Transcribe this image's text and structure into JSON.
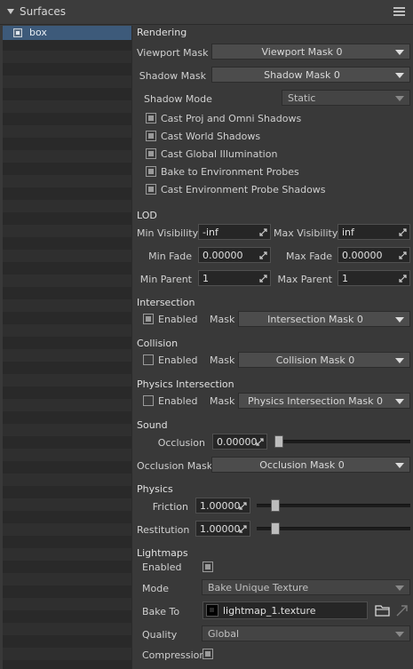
{
  "panel": {
    "title": "Surfaces",
    "menu_icon": "hamburger-icon"
  },
  "tree": {
    "items": [
      {
        "label": "box",
        "checked": true
      }
    ]
  },
  "rendering": {
    "title": "Rendering",
    "viewport_mask": {
      "label": "Viewport Mask",
      "value": "Viewport Mask 0"
    },
    "shadow_mask": {
      "label": "Shadow Mask",
      "value": "Shadow Mask 0"
    },
    "shadow_mode": {
      "label": "Shadow Mode",
      "value": "Static"
    },
    "checks": [
      {
        "label": "Cast Proj and Omni Shadows",
        "checked": true
      },
      {
        "label": "Cast World Shadows",
        "checked": true
      },
      {
        "label": "Cast Global Illumination",
        "checked": true
      },
      {
        "label": "Bake to Environment Probes",
        "checked": true
      },
      {
        "label": "Cast Environment Probe Shadows",
        "checked": true
      }
    ]
  },
  "lod": {
    "title": "LOD",
    "min_visibility": {
      "label": "Min Visibility",
      "value": "-inf"
    },
    "max_visibility": {
      "label": "Max Visibility",
      "value": "inf"
    },
    "min_fade": {
      "label": "Min Fade",
      "value": "0.00000"
    },
    "max_fade": {
      "label": "Max Fade",
      "value": "0.00000"
    },
    "min_parent": {
      "label": "Min Parent",
      "value": "1"
    },
    "max_parent": {
      "label": "Max Parent",
      "value": "1"
    }
  },
  "intersection": {
    "title": "Intersection",
    "enabled_label": "Enabled",
    "enabled": true,
    "mask_label": "Mask",
    "mask_value": "Intersection Mask 0"
  },
  "collision": {
    "title": "Collision",
    "enabled_label": "Enabled",
    "enabled": false,
    "mask_label": "Mask",
    "mask_value": "Collision Mask 0"
  },
  "physics_intersection": {
    "title": "Physics Intersection",
    "enabled_label": "Enabled",
    "enabled": false,
    "mask_label": "Mask",
    "mask_value": "Physics Intersection Mask 0"
  },
  "sound": {
    "title": "Sound",
    "occlusion": {
      "label": "Occlusion",
      "value": "0.00000",
      "level": 0.0
    },
    "occlusion_mask": {
      "label": "Occlusion Mask",
      "value": "Occlusion Mask 0"
    }
  },
  "physics": {
    "title": "Physics",
    "friction": {
      "label": "Friction",
      "value": "1.00000",
      "level": 0.1
    },
    "restitution": {
      "label": "Restitution",
      "value": "1.00000",
      "level": 0.1
    }
  },
  "lightmaps": {
    "title": "Lightmaps",
    "enabled_label": "Enabled",
    "enabled": true,
    "mode": {
      "label": "Mode",
      "value": "Bake Unique Texture"
    },
    "bake_to": {
      "label": "Bake To",
      "value": "lightmap_1.texture"
    },
    "quality": {
      "label": "Quality",
      "value": "Global"
    },
    "compression_label": "Compression",
    "compression": true
  }
}
